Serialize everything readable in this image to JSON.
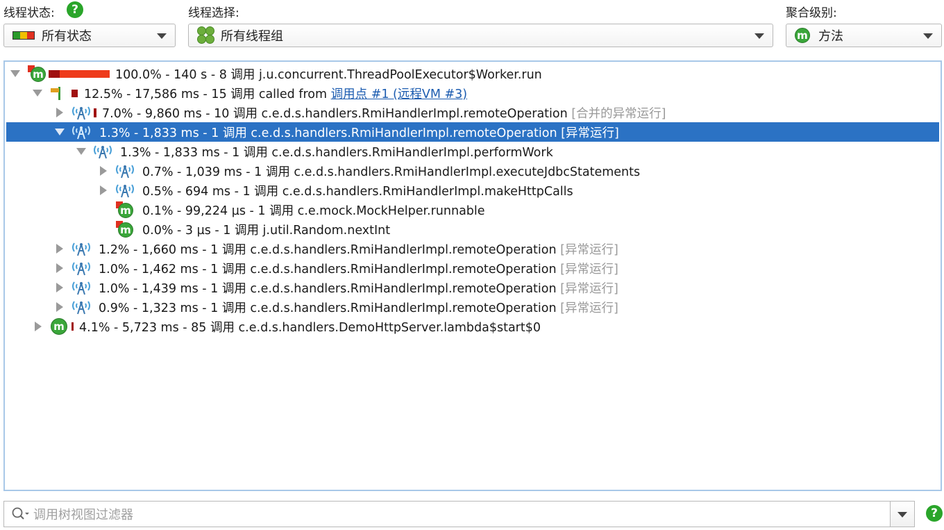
{
  "toolbar": {
    "thread_status_label": "线程状态:",
    "thread_status_value": "所有状态",
    "thread_select_label": "线程选择:",
    "thread_select_value": "所有线程组",
    "aggregation_label": "聚合级别:",
    "aggregation_value": "方法",
    "help_glyph": "?"
  },
  "icons": {
    "method_glyph": "m",
    "status_colors": [
      "#2a9a2a",
      "#f0c000",
      "#e03020"
    ],
    "accent": "#2aa52a",
    "selection": "#2b72c4"
  },
  "tree": {
    "rows": [
      {
        "text": "100.0% - 140 s - 8 调用 j.u.concurrent.ThreadPoolExecutor$Worker.run",
        "suffix": "",
        "link": "",
        "icon": "method-hot-icon"
      },
      {
        "text": "12.5% - 17,586 ms - 15 调用 called from ",
        "suffix": "",
        "link": "调用点 #1 (远程VM #3)",
        "icon": "flag-icon"
      },
      {
        "text": "7.0% - 9,860 ms - 10 调用 c.e.d.s.handlers.RmiHandlerImpl.remoteOperation ",
        "suffix": "[合并的异常运行]",
        "link": "",
        "icon": "antenna-icon"
      },
      {
        "text": "1.3% - 1,833 ms - 1 调用 c.e.d.s.handlers.RmiHandlerImpl.remoteOperation ",
        "suffix": "[异常运行]",
        "link": "",
        "icon": "antenna-icon"
      },
      {
        "text": "1.3% - 1,833 ms - 1 调用 c.e.d.s.handlers.RmiHandlerImpl.performWork",
        "suffix": "",
        "link": "",
        "icon": "antenna-icon"
      },
      {
        "text": "0.7% - 1,039 ms - 1 调用 c.e.d.s.handlers.RmiHandlerImpl.executeJdbcStatements",
        "suffix": "",
        "link": "",
        "icon": "antenna-icon"
      },
      {
        "text": "0.5% - 694 ms - 1 调用 c.e.d.s.handlers.RmiHandlerImpl.makeHttpCalls",
        "suffix": "",
        "link": "",
        "icon": "antenna-icon"
      },
      {
        "text": "0.1% - 99,224 µs - 1 调用 c.e.mock.MockHelper.runnable",
        "suffix": "",
        "link": "",
        "icon": "method-icon"
      },
      {
        "text": "0.0% - 3 µs - 1 调用 j.util.Random.nextInt",
        "suffix": "",
        "link": "",
        "icon": "method-icon"
      },
      {
        "text": "1.2% - 1,660 ms - 1 调用 c.e.d.s.handlers.RmiHandlerImpl.remoteOperation ",
        "suffix": "[异常运行]",
        "link": "",
        "icon": "antenna-icon"
      },
      {
        "text": "1.0% - 1,462 ms - 1 调用 c.e.d.s.handlers.RmiHandlerImpl.remoteOperation ",
        "suffix": "[异常运行]",
        "link": "",
        "icon": "antenna-icon"
      },
      {
        "text": "1.0% - 1,439 ms - 1 调用 c.e.d.s.handlers.RmiHandlerImpl.remoteOperation ",
        "suffix": "[异常运行]",
        "link": "",
        "icon": "antenna-icon"
      },
      {
        "text": "0.9% - 1,323 ms - 1 调用 c.e.d.s.handlers.RmiHandlerImpl.remoteOperation ",
        "suffix": "[异常运行]",
        "link": "",
        "icon": "antenna-icon"
      },
      {
        "text": "4.1% - 5,723 ms - 85 调用 c.e.d.s.handlers.DemoHttpServer.lambda$start$0",
        "suffix": "",
        "link": "",
        "icon": "method-icon"
      }
    ]
  },
  "filter": {
    "placeholder": "调用树视图过滤器"
  }
}
